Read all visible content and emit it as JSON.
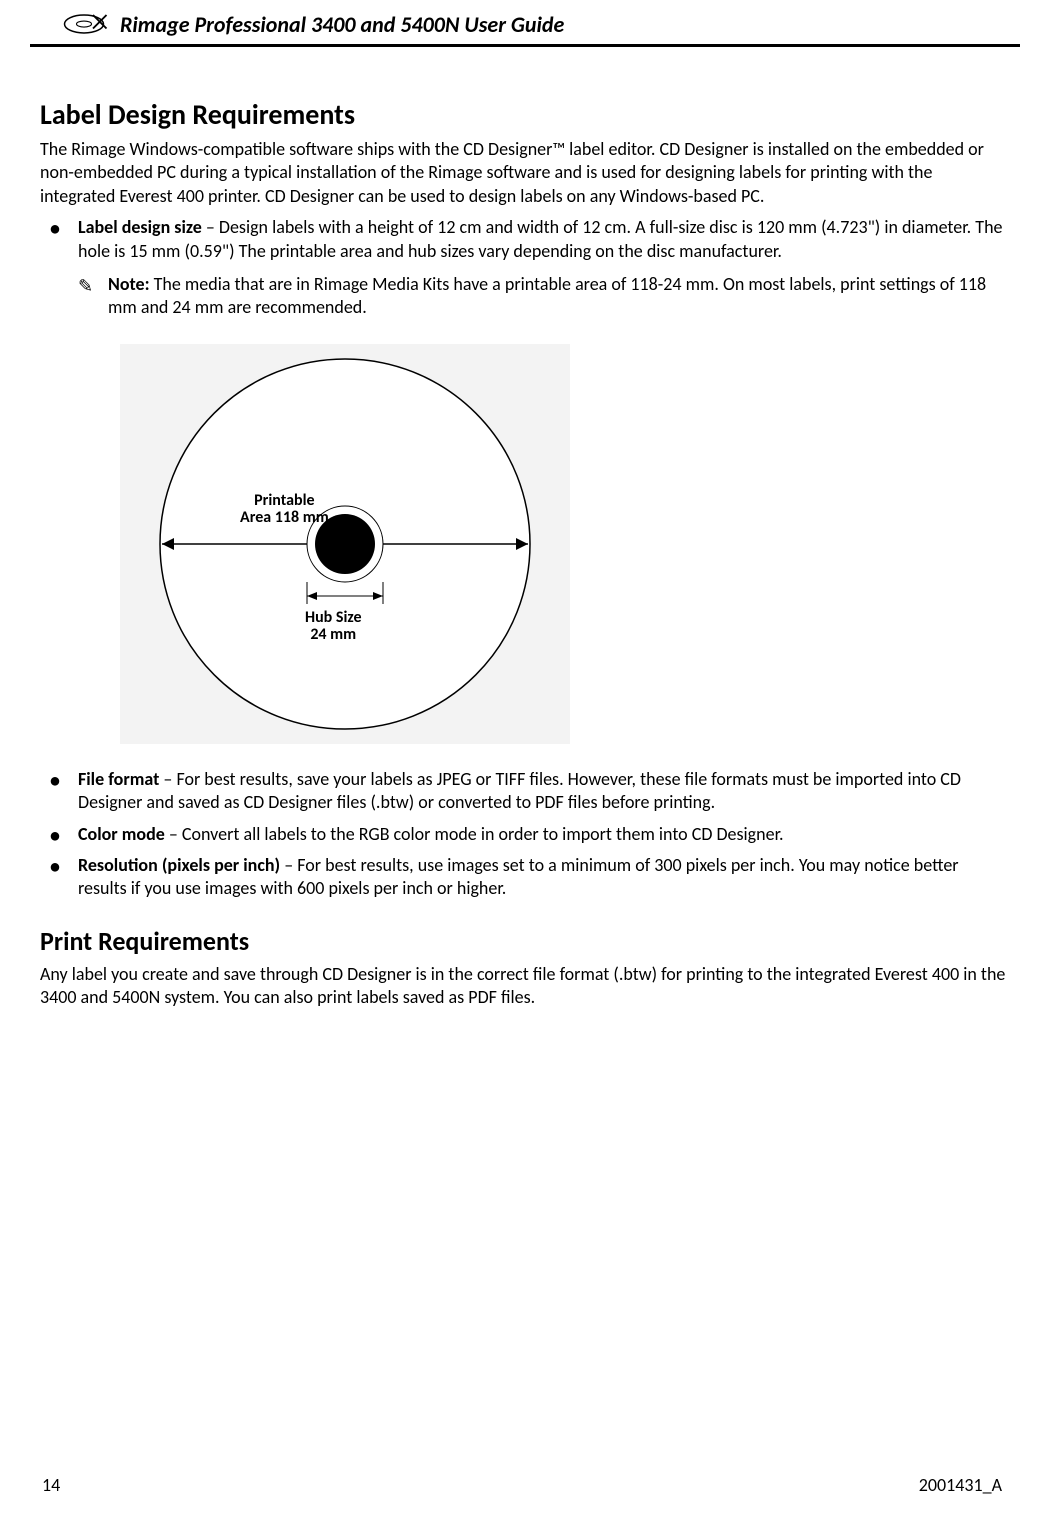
{
  "header_title": "Rimage Professional 3400 and 5400N User Guide",
  "section1_title": "Label Design Requirements",
  "intro": "The Rimage Windows-compatible software ships with the CD Designer™ label editor. CD Designer is installed on the embedded or non-embedded PC during a typical installation of the Rimage software and is used for designing labels for printing with the integrated Everest 400 printer. CD Designer can be used to design labels on any Windows-based PC.",
  "bullet1_label": "Label design size",
  "bullet1_text": " – Design labels with a height of 12 cm and width of 12 cm. A full-size disc is 120 mm (4.723\") in diameter. The hole is 15 mm (0.59\") The printable area and hub sizes vary depending on the disc manufacturer.",
  "note_label": "Note:",
  "note_text": " The media that are in Rimage Media Kits have a printable area of 118-24 mm. On most labels, print settings of 118 mm and 24 mm are recommended.",
  "diagram": {
    "printable_line1": "Printable",
    "printable_line2": "Area 118 mm",
    "hub_line1": "Hub Size",
    "hub_line2": "24 mm"
  },
  "bullet2_label": "File format",
  "bullet2_text": " – For best results, save your labels as JPEG or TIFF files. However, these file formats must be imported into CD Designer and saved as CD Designer files (.btw) or converted to PDF files before printing.",
  "bullet3_label": "Color mode",
  "bullet3_text": " – Convert all labels to the RGB color mode in order to import them into CD Designer.",
  "bullet4_label": "Resolution (pixels per inch)",
  "bullet4_text": " – For best results, use images set to a minimum of 300 pixels per inch. You may notice better results if you use images with 600 pixels per inch or higher.",
  "section2_title": "Print Requirements",
  "section2_para": "Any label you create and save through CD Designer is in the correct file format (.btw) for printing to the integrated Everest 400 in the 3400 and 5400N system. You can also print labels saved as PDF files.",
  "footer_page": "14",
  "footer_doc": "2001431_A"
}
